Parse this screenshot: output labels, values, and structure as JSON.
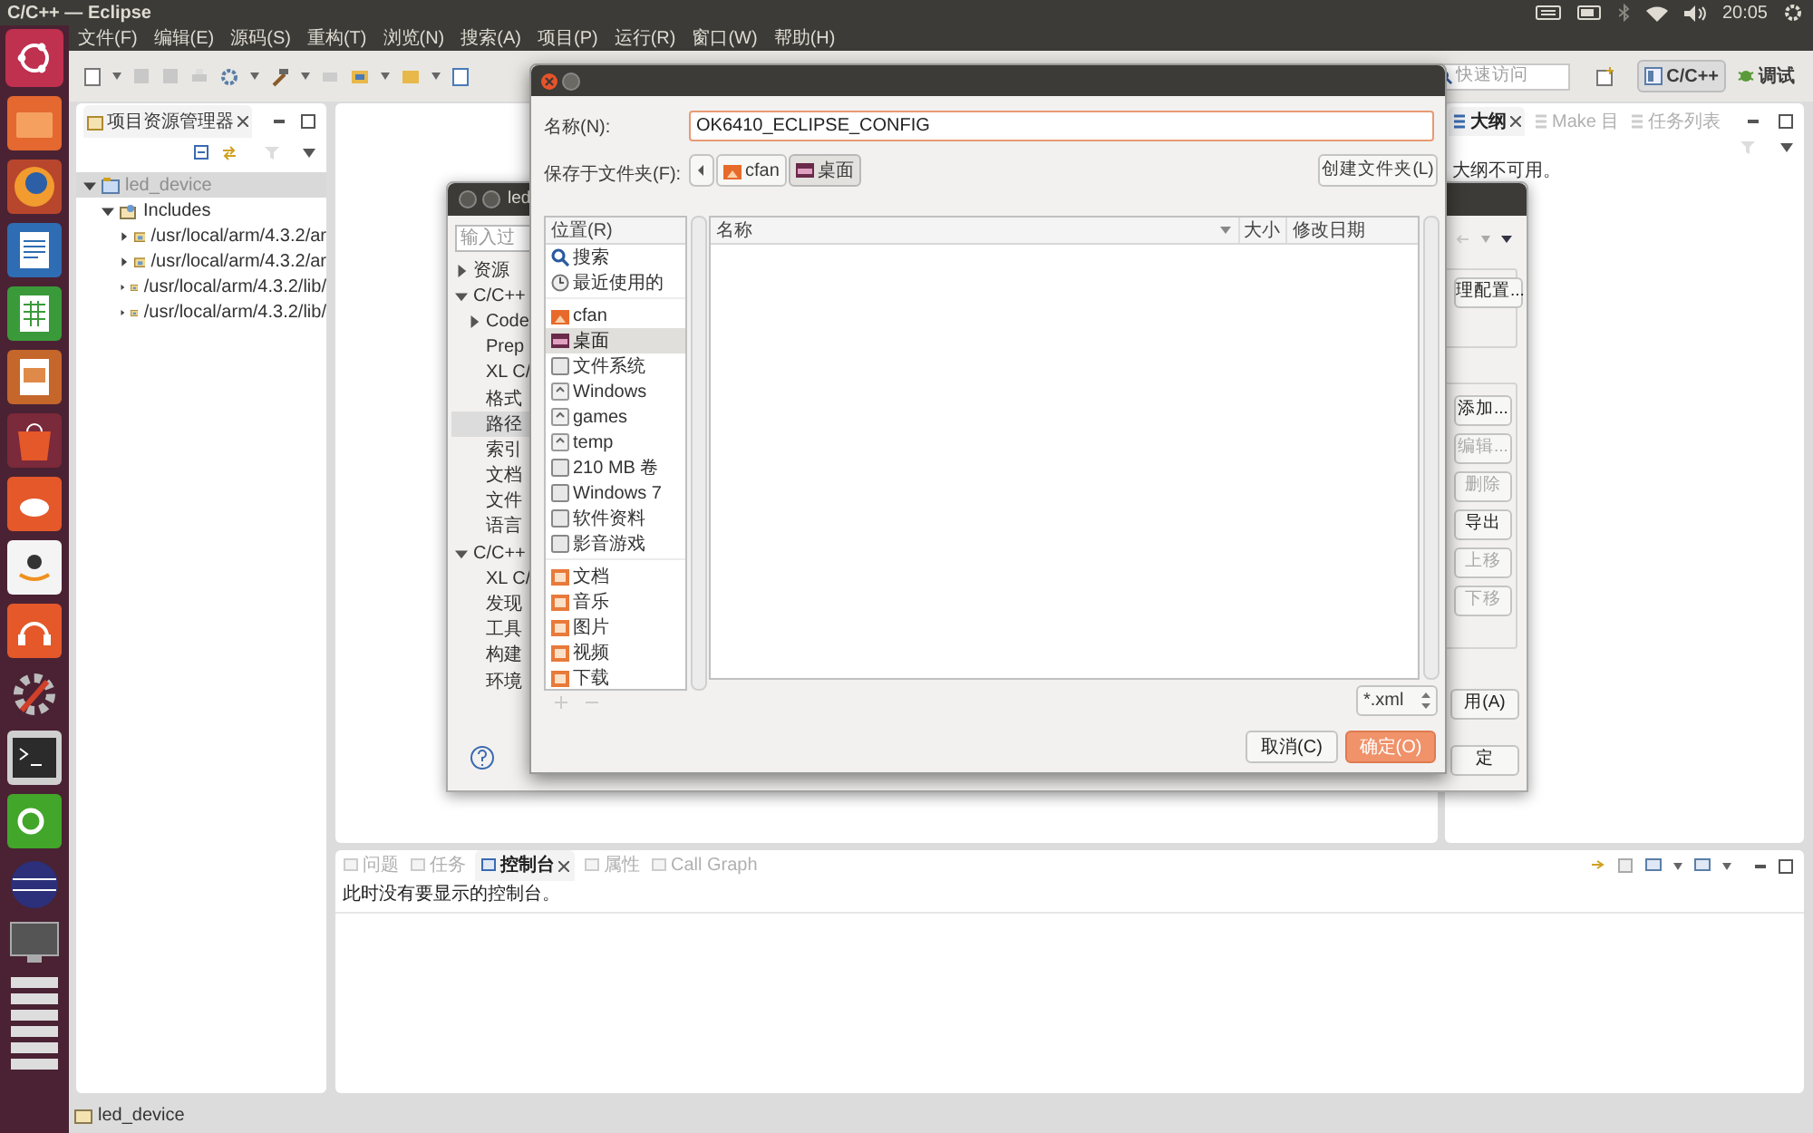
{
  "top_panel": {
    "title": "C/C++ — Eclipse",
    "clock": "20:05"
  },
  "menu": [
    "文件(F)",
    "编辑(E)",
    "源码(S)",
    "重构(T)",
    "浏览(N)",
    "搜索(A)",
    "项目(P)",
    "运行(R)",
    "窗口(W)",
    "帮助(H)"
  ],
  "toolbar": {
    "quick_access": {
      "placeholder": "快速访问"
    },
    "perspectives": [
      {
        "label": "C/C++",
        "selected": true
      },
      {
        "label": "调试",
        "selected": false
      }
    ]
  },
  "project_explorer": {
    "tab": "项目资源管理器",
    "tree": [
      {
        "label": "led_device",
        "selected": true,
        "expanded": true,
        "children": [
          {
            "label": "Includes",
            "selected": false,
            "expanded": true,
            "children": [
              {
                "label": "/usr/local/arm/4.3.2/ar",
                "selected": false,
                "expanded": false
              },
              {
                "label": "/usr/local/arm/4.3.2/ar",
                "selected": false,
                "expanded": false
              },
              {
                "label": "/usr/local/arm/4.3.2/lib/",
                "selected": false,
                "expanded": false
              },
              {
                "label": "/usr/local/arm/4.3.2/lib/",
                "selected": false,
                "expanded": false
              }
            ]
          }
        ]
      }
    ]
  },
  "outline": {
    "tabs": [
      {
        "label": "大纲",
        "selected": true
      },
      {
        "label": "Make 目",
        "selected": false
      },
      {
        "label": "任务列表",
        "selected": false
      }
    ],
    "message": "大纲不可用。"
  },
  "console": {
    "tabs": [
      {
        "label": "问题",
        "selected": false
      },
      {
        "label": "任务",
        "selected": false
      },
      {
        "label": "控制台",
        "selected": true
      },
      {
        "label": "属性",
        "selected": false
      },
      {
        "label": "Call Graph",
        "selected": false
      }
    ],
    "message": "此时没有要显示的控制台。"
  },
  "status_bar": {
    "text": "led_device"
  },
  "properties_dialog": {
    "title": "led",
    "filter": {
      "placeholder": "输入过"
    },
    "tree": [
      {
        "label": "资源",
        "selected": false,
        "expanded": false
      },
      {
        "label": "C/C++",
        "selected": false,
        "expanded": true,
        "children": [
          {
            "label": "Code",
            "selected": false,
            "expanded": false
          },
          {
            "label": "Prep",
            "selected": false
          },
          {
            "label": "XL C/",
            "selected": false
          },
          {
            "label": "格式",
            "selected": false
          },
          {
            "label": "路径",
            "selected": true
          },
          {
            "label": "索引",
            "selected": false
          },
          {
            "label": "文档",
            "selected": false
          },
          {
            "label": "文件",
            "selected": false
          },
          {
            "label": "语言",
            "selected": false
          }
        ]
      },
      {
        "label": "C/C++",
        "selected": false,
        "expanded": true,
        "children": [
          {
            "label": "XL C/",
            "selected": false
          },
          {
            "label": "发现",
            "selected": false
          },
          {
            "label": "工具",
            "selected": false
          },
          {
            "label": "构建",
            "selected": false
          },
          {
            "label": "环境",
            "selected": false
          }
        ]
      }
    ],
    "config_buttons": [
      {
        "label": "理配置...",
        "disabled": false
      }
    ],
    "entry_buttons": [
      {
        "label": "添加...",
        "disabled": false
      },
      {
        "label": "编辑...",
        "disabled": true
      },
      {
        "label": "删除",
        "disabled": true
      },
      {
        "label": "导出",
        "disabled": false
      },
      {
        "label": "上移",
        "disabled": true
      },
      {
        "label": "下移",
        "disabled": true
      }
    ],
    "footer_buttons": [
      {
        "label": "用(A)",
        "disabled": false
      },
      {
        "label": "定",
        "disabled": false
      }
    ]
  },
  "save_dialog": {
    "name_label": "名称(N):",
    "name_value": "OK6410_ECLIPSE_CONFIG",
    "folder_label": "保存于文件夹(F):",
    "path": [
      {
        "label": "cfan",
        "kind": "home",
        "selected": false
      },
      {
        "label": "桌面",
        "kind": "desktop",
        "selected": true
      }
    ],
    "create_folder": "创建文件夹(L)",
    "places_header": "位置(R)",
    "place_groups": [
      {
        "items": [
          {
            "label": "搜索",
            "kind": "search",
            "selected": false
          },
          {
            "label": "最近使用的",
            "kind": "recent",
            "selected": false
          }
        ]
      },
      {
        "items": [
          {
            "label": "cfan",
            "kind": "home",
            "selected": false
          },
          {
            "label": "桌面",
            "kind": "desktop",
            "selected": true
          },
          {
            "label": "文件系统",
            "kind": "drive",
            "selected": false
          },
          {
            "label": "Windows",
            "kind": "mount",
            "selected": false
          },
          {
            "label": "games",
            "kind": "mount",
            "selected": false
          },
          {
            "label": "temp",
            "kind": "mount",
            "selected": false
          },
          {
            "label": "210 MB 卷",
            "kind": "drive",
            "selected": false
          },
          {
            "label": "Windows 7",
            "kind": "drive",
            "selected": false
          },
          {
            "label": "软件资料",
            "kind": "drive",
            "selected": false
          },
          {
            "label": "影音游戏",
            "kind": "drive",
            "selected": false
          }
        ]
      },
      {
        "items": [
          {
            "label": "文档",
            "kind": "folder",
            "selected": false
          },
          {
            "label": "音乐",
            "kind": "folder",
            "selected": false
          },
          {
            "label": "图片",
            "kind": "folder",
            "selected": false
          },
          {
            "label": "视频",
            "kind": "folder",
            "selected": false
          },
          {
            "label": "下载",
            "kind": "folder",
            "selected": false
          }
        ]
      }
    ],
    "columns": [
      "名称",
      "大小",
      "修改日期"
    ],
    "filter": "*.xml",
    "buttons": [
      {
        "label": "取消(C)",
        "kind": "cancel"
      },
      {
        "label": "确定(O)",
        "kind": "ok"
      }
    ]
  }
}
